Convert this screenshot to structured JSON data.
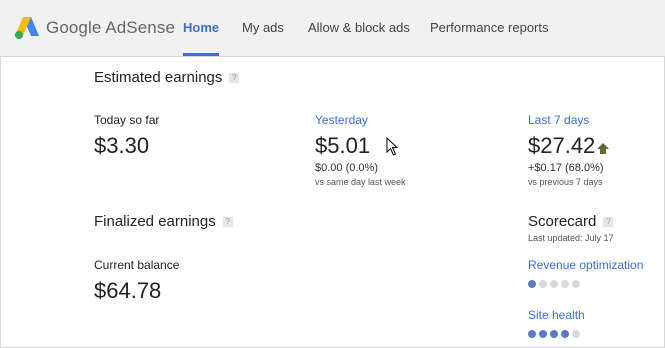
{
  "header": {
    "logo_text": "Google AdSense",
    "tabs": [
      {
        "label": "Home",
        "active": true
      },
      {
        "label": "My ads"
      },
      {
        "label": "Allow & block ads"
      },
      {
        "label": "Performance reports"
      }
    ],
    "accent_color": "#3b6fd1"
  },
  "estimated": {
    "title": "Estimated earnings",
    "help_glyph": "?",
    "today": {
      "label": "Today so far",
      "value": "$3.30"
    },
    "yesterday": {
      "label": "Yesterday",
      "value": "$5.01",
      "change": "$0.00 (0.0%)",
      "comparison": "vs same day last week"
    },
    "last7": {
      "label": "Last 7 days",
      "value": "$27.42",
      "trend_icon": "up-arrow-icon",
      "change": "+$0.17 (68.0%)",
      "comparison": "vs previous 7 days"
    }
  },
  "finalized": {
    "title": "Finalized earnings",
    "help_glyph": "?",
    "balance_label": "Current balance",
    "balance_value": "$64.78"
  },
  "scorecard": {
    "title": "Scorecard",
    "help_glyph": "?",
    "updated": "Last updated: July 17",
    "metrics": [
      {
        "label": "Revenue optimization",
        "score": 1,
        "max": 5
      },
      {
        "label": "Site health",
        "score": 4,
        "max": 5
      }
    ]
  }
}
